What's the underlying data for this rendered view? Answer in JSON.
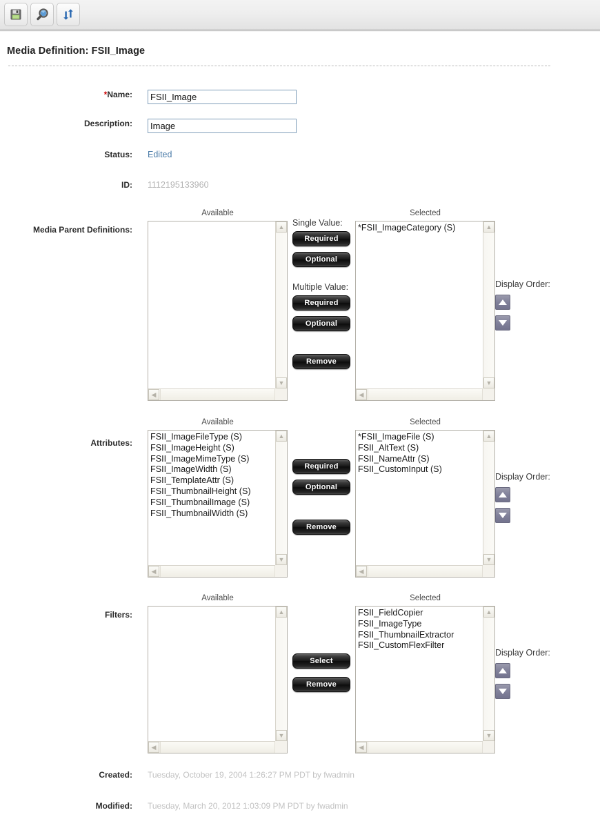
{
  "toolbar": {
    "buttons": [
      {
        "name": "save-button",
        "icon": "floppy-disk-icon"
      },
      {
        "name": "inspect-button",
        "icon": "magnifier-icon"
      },
      {
        "name": "refresh-button",
        "icon": "sync-arrows-icon"
      }
    ]
  },
  "page": {
    "title": "Media Definition: FSII_Image"
  },
  "fields": {
    "name": {
      "label": "*Name:",
      "label_star": "*",
      "label_text": "Name:",
      "value": "FSII_Image"
    },
    "description": {
      "label": "Description:",
      "value": "Image"
    },
    "status": {
      "label": "Status:",
      "value": "Edited"
    },
    "id": {
      "label": "ID:",
      "value": "1112195133960"
    },
    "created": {
      "label": "Created:",
      "value": "Tuesday, October 19, 2004 1:26:27 PM PDT by fwadmin"
    },
    "modified": {
      "label": "Modified:",
      "value": "Tuesday, March 20, 2012 1:03:09 PM PDT by fwadmin"
    }
  },
  "captions": {
    "available": "Available",
    "selected": "Selected",
    "display_order": "Display Order:"
  },
  "media_parent_definitions": {
    "label": "Media Parent Definitions:",
    "available": [],
    "selected": [
      "*FSII_ImageCategory (S)"
    ],
    "single_value_label": "Single Value:",
    "multiple_value_label": "Multiple Value:",
    "single_required": "Required",
    "single_optional": "Optional",
    "multi_required": "Required",
    "multi_optional": "Optional",
    "remove": "Remove"
  },
  "attributes": {
    "label": "Attributes:",
    "available": [
      "FSII_ImageFileType (S)",
      "FSII_ImageHeight (S)",
      "FSII_ImageMimeType (S)",
      "FSII_ImageWidth (S)",
      "FSII_TemplateAttr (S)",
      "FSII_ThumbnailHeight (S)",
      "FSII_ThumbnailImage (S)",
      "FSII_ThumbnailWidth (S)"
    ],
    "selected": [
      "*FSII_ImageFile (S)",
      "FSII_AltText (S)",
      "FSII_NameAttr (S)",
      "FSII_CustomInput (S)"
    ],
    "required": "Required",
    "optional": "Optional",
    "remove": "Remove"
  },
  "filters": {
    "label": "Filters:",
    "available": [],
    "selected": [
      "FSII_FieldCopier",
      "FSII_ImageType",
      "FSII_ThumbnailExtractor",
      "FSII_CustomFlexFilter"
    ],
    "select": "Select",
    "remove": "Remove"
  },
  "colors": {
    "accent_link": "#4a7ba8",
    "required_star": "#cc0000",
    "muted_text": "#c2c2c2",
    "arrow_button": "#81819a",
    "input_border": "#7e9db9"
  },
  "scroll_glyphs": {
    "up": "▲",
    "down": "▼",
    "left": "◀",
    "right": "▶"
  }
}
